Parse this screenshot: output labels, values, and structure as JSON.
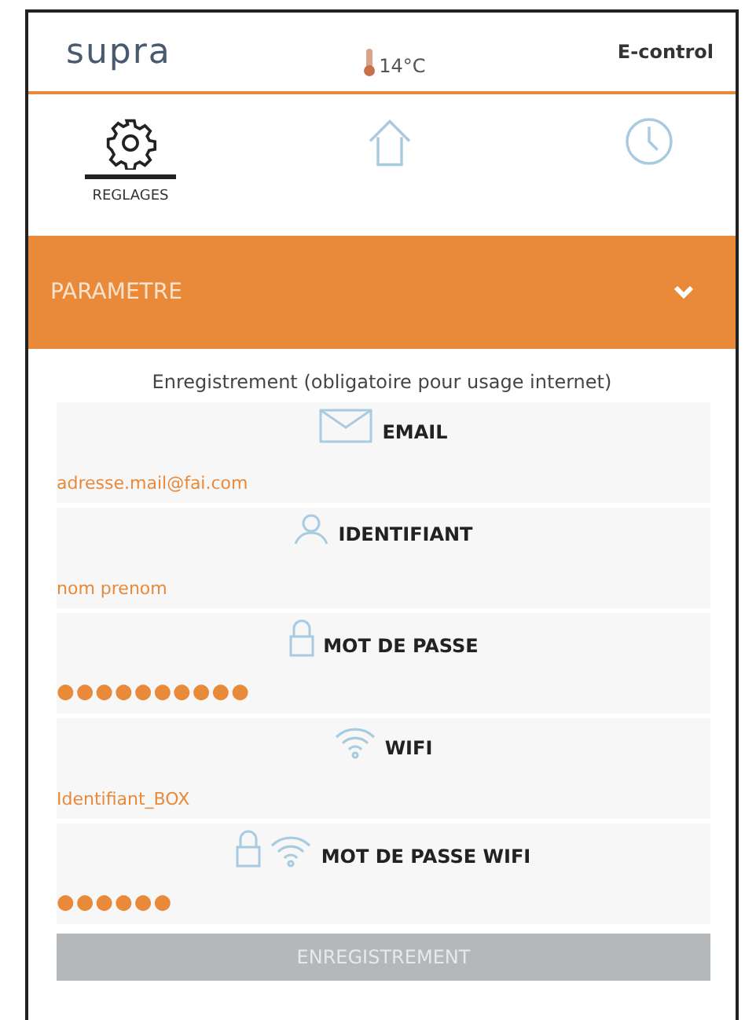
{
  "header": {
    "logo": "supra",
    "temperature": "14°C",
    "title": "E-control"
  },
  "tabs": [
    {
      "kind": "settings",
      "label": "REGLAGES",
      "selected": true
    },
    {
      "kind": "home",
      "selected": false
    },
    {
      "kind": "clock",
      "selected": false
    }
  ],
  "section": {
    "title": "PARAMETRE",
    "expanded": true,
    "subtitle": "Enregistrement (obligatoire pour usage internet)"
  },
  "fields": [
    {
      "kind": "email",
      "label": "EMAIL",
      "value": "adresse.mail@fai.com"
    },
    {
      "kind": "user",
      "label": "IDENTIFIANT",
      "value": "nom prenom"
    },
    {
      "kind": "lock",
      "label": "MOT DE PASSE",
      "value": "●●●●●●●●●●"
    },
    {
      "kind": "wifi",
      "label": "WIFI",
      "value": "Identifiant_BOX"
    },
    {
      "kind": "lockwifi",
      "label": "MOT DE PASSE WIFI",
      "value": "●●●●●●"
    }
  ],
  "button": {
    "label": "ENREGISTREMENT",
    "disabled": true
  }
}
